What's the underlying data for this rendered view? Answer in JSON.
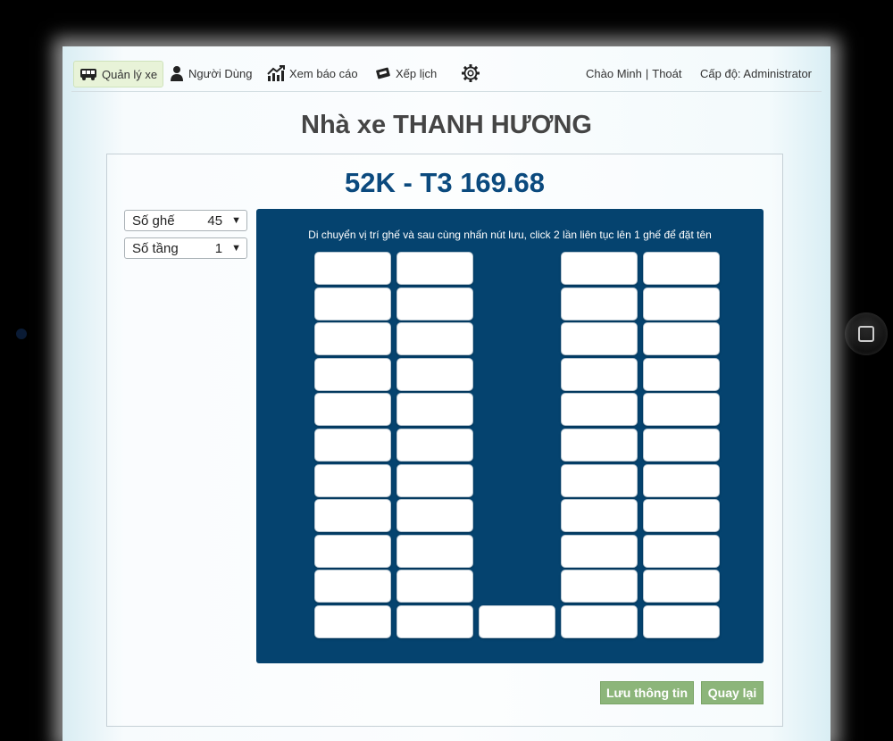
{
  "nav": {
    "items": [
      {
        "label": "Quản lý xe",
        "icon": "bus-icon"
      },
      {
        "label": "Người Dùng",
        "icon": "user-icon"
      },
      {
        "label": "Xem báo cáo",
        "icon": "chart-icon"
      },
      {
        "label": "Xếp lịch",
        "icon": "ticket-icon"
      }
    ],
    "settings_icon": "gear-icon",
    "greeting": "Chào Minh",
    "separator": "|",
    "logout": "Thoát",
    "level": "Cấp độ: Administrator"
  },
  "page_title": "Nhà xe THANH HƯƠNG",
  "plate": "52K - T3 169.68",
  "seat_count": {
    "label": "Số ghế",
    "value": "45"
  },
  "floor_count": {
    "label": "Số tầng",
    "value": "1"
  },
  "hint": "Di chuyển vị trí ghế và sau cùng nhấn nút lưu, click 2 lần liên tục lên 1 ghế để đặt tên",
  "buttons": {
    "save": "Lưu thông tin",
    "back": "Quay lại"
  },
  "colors": {
    "seat_area": "#05436f",
    "title": "#0b4a7e",
    "button": "#8cb57a"
  }
}
